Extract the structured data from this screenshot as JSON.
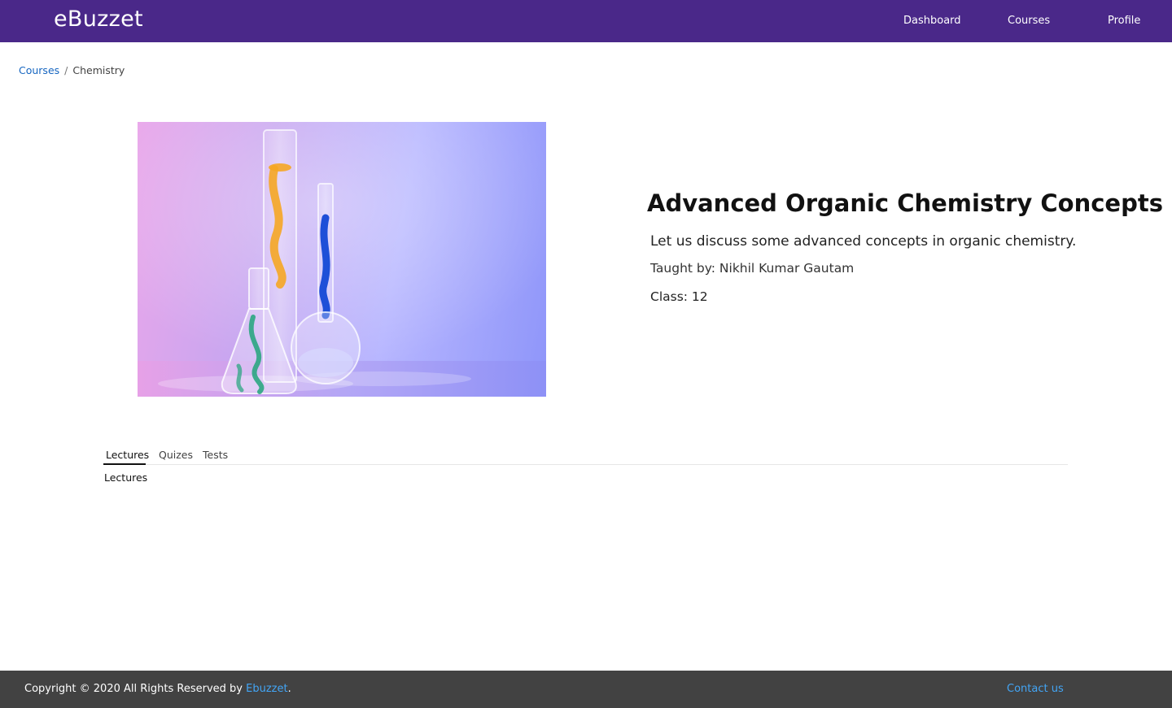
{
  "navbar": {
    "brand": "eBuzzet",
    "links": [
      "Dashboard",
      "Courses",
      "Profile"
    ],
    "background_color": "#4a2889"
  },
  "breadcrumb": {
    "parent": "Courses",
    "separator": "/",
    "current": "Chemistry"
  },
  "course": {
    "title": "Advanced Organic Chemistry Concepts",
    "description": "Let us discuss some advanced concepts in organic chemistry.",
    "teacher": "Taught by: Nikhil Kumar Gautam",
    "class": "Class: 12"
  },
  "tabs": {
    "items": [
      "Lectures",
      "Quizes",
      "Tests"
    ],
    "active": "Lectures",
    "content": "Lectures"
  },
  "footer": {
    "copyright_prefix": "Copyright © 2020 All Rights Reserved by ",
    "brand_link": "Ebuzzet",
    "copyright_suffix": ".",
    "contact": "Contact us",
    "background_color": "#424242",
    "link_color": "#42a5f5"
  }
}
